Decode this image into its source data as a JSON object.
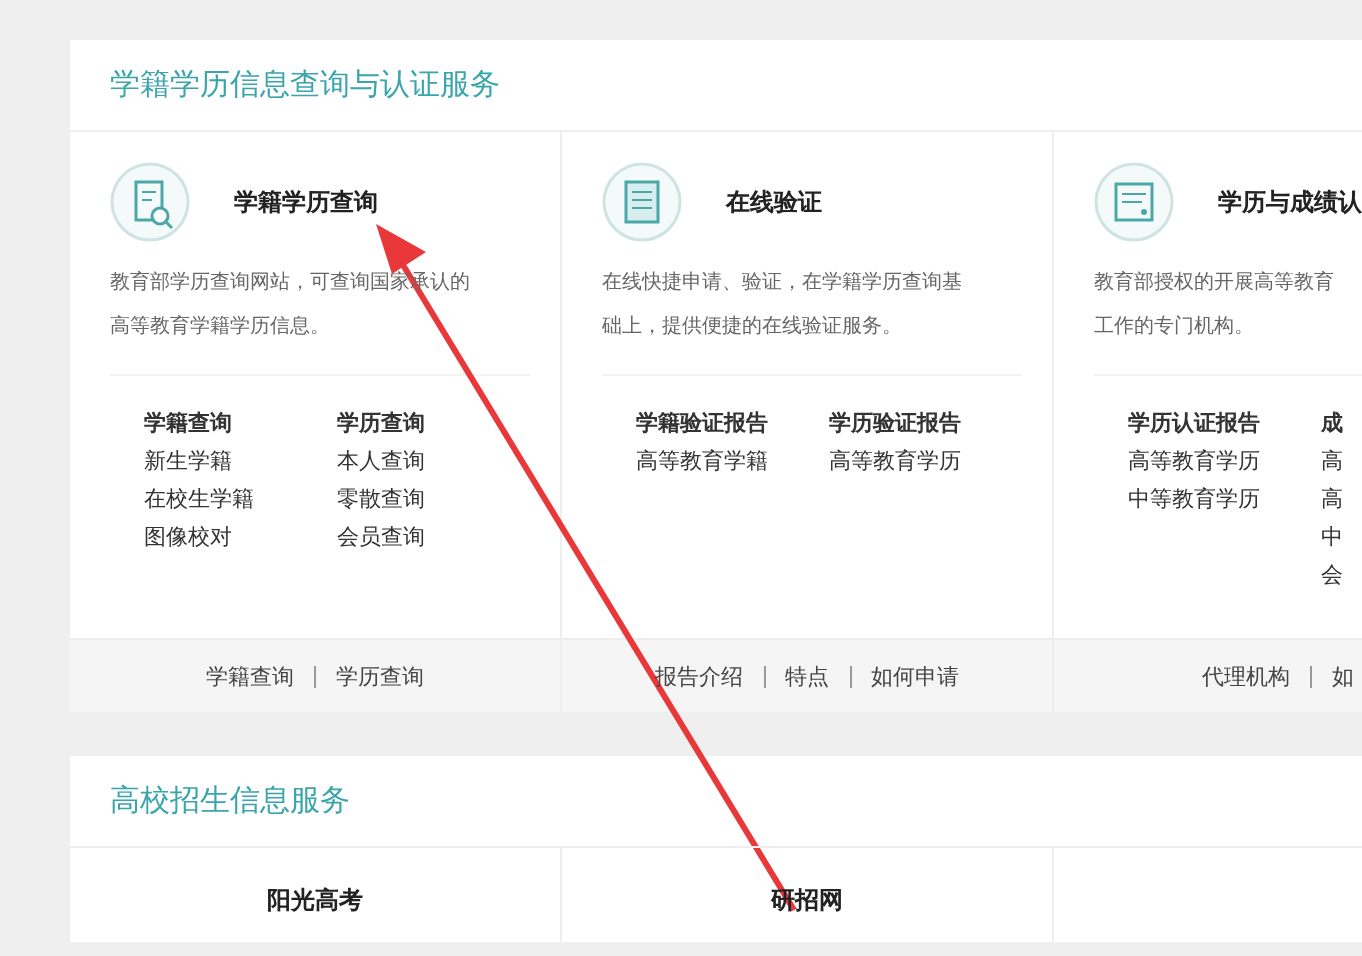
{
  "sections": [
    {
      "title": "学籍学历信息查询与认证服务",
      "services": [
        {
          "kind": "search",
          "name": "学籍学历查询",
          "desc_lines": [
            "教育部学历查询网站，可查询国家承认的",
            "高等教育学籍学历信息。"
          ],
          "link_groups": [
            {
              "title": "学籍查询",
              "items": [
                "新生学籍",
                "在校生学籍",
                "图像校对"
              ]
            },
            {
              "title": "学历查询",
              "items": [
                "本人查询",
                "零散查询",
                "会员查询"
              ]
            }
          ],
          "footer": [
            "学籍查询",
            "学历查询"
          ]
        },
        {
          "kind": "doc",
          "name": "在线验证",
          "desc_lines": [
            "在线快捷申请、验证，在学籍学历查询基",
            "础上，提供便捷的在线验证服务。"
          ],
          "link_groups": [
            {
              "title": "学籍验证报告",
              "items": [
                "高等教育学籍"
              ]
            },
            {
              "title": "学历验证报告",
              "items": [
                "高等教育学历"
              ]
            }
          ],
          "footer": [
            "报告介绍",
            "特点",
            "如何申请"
          ]
        },
        {
          "kind": "cert",
          "name": "学历与成绩认",
          "desc_lines": [
            "教育部授权的开展高等教育",
            "工作的专门机构。"
          ],
          "link_groups": [
            {
              "title": "学历认证报告",
              "items": [
                "高等教育学历",
                "中等教育学历"
              ]
            },
            {
              "title": "成",
              "items": [
                "高",
                "高",
                "中",
                "会"
              ]
            }
          ],
          "footer": [
            "代理机构",
            "如"
          ]
        }
      ]
    },
    {
      "title": "高校招生信息服务",
      "services": [
        {
          "name": "阳光高考"
        },
        {
          "name": "研招网"
        }
      ]
    }
  ]
}
